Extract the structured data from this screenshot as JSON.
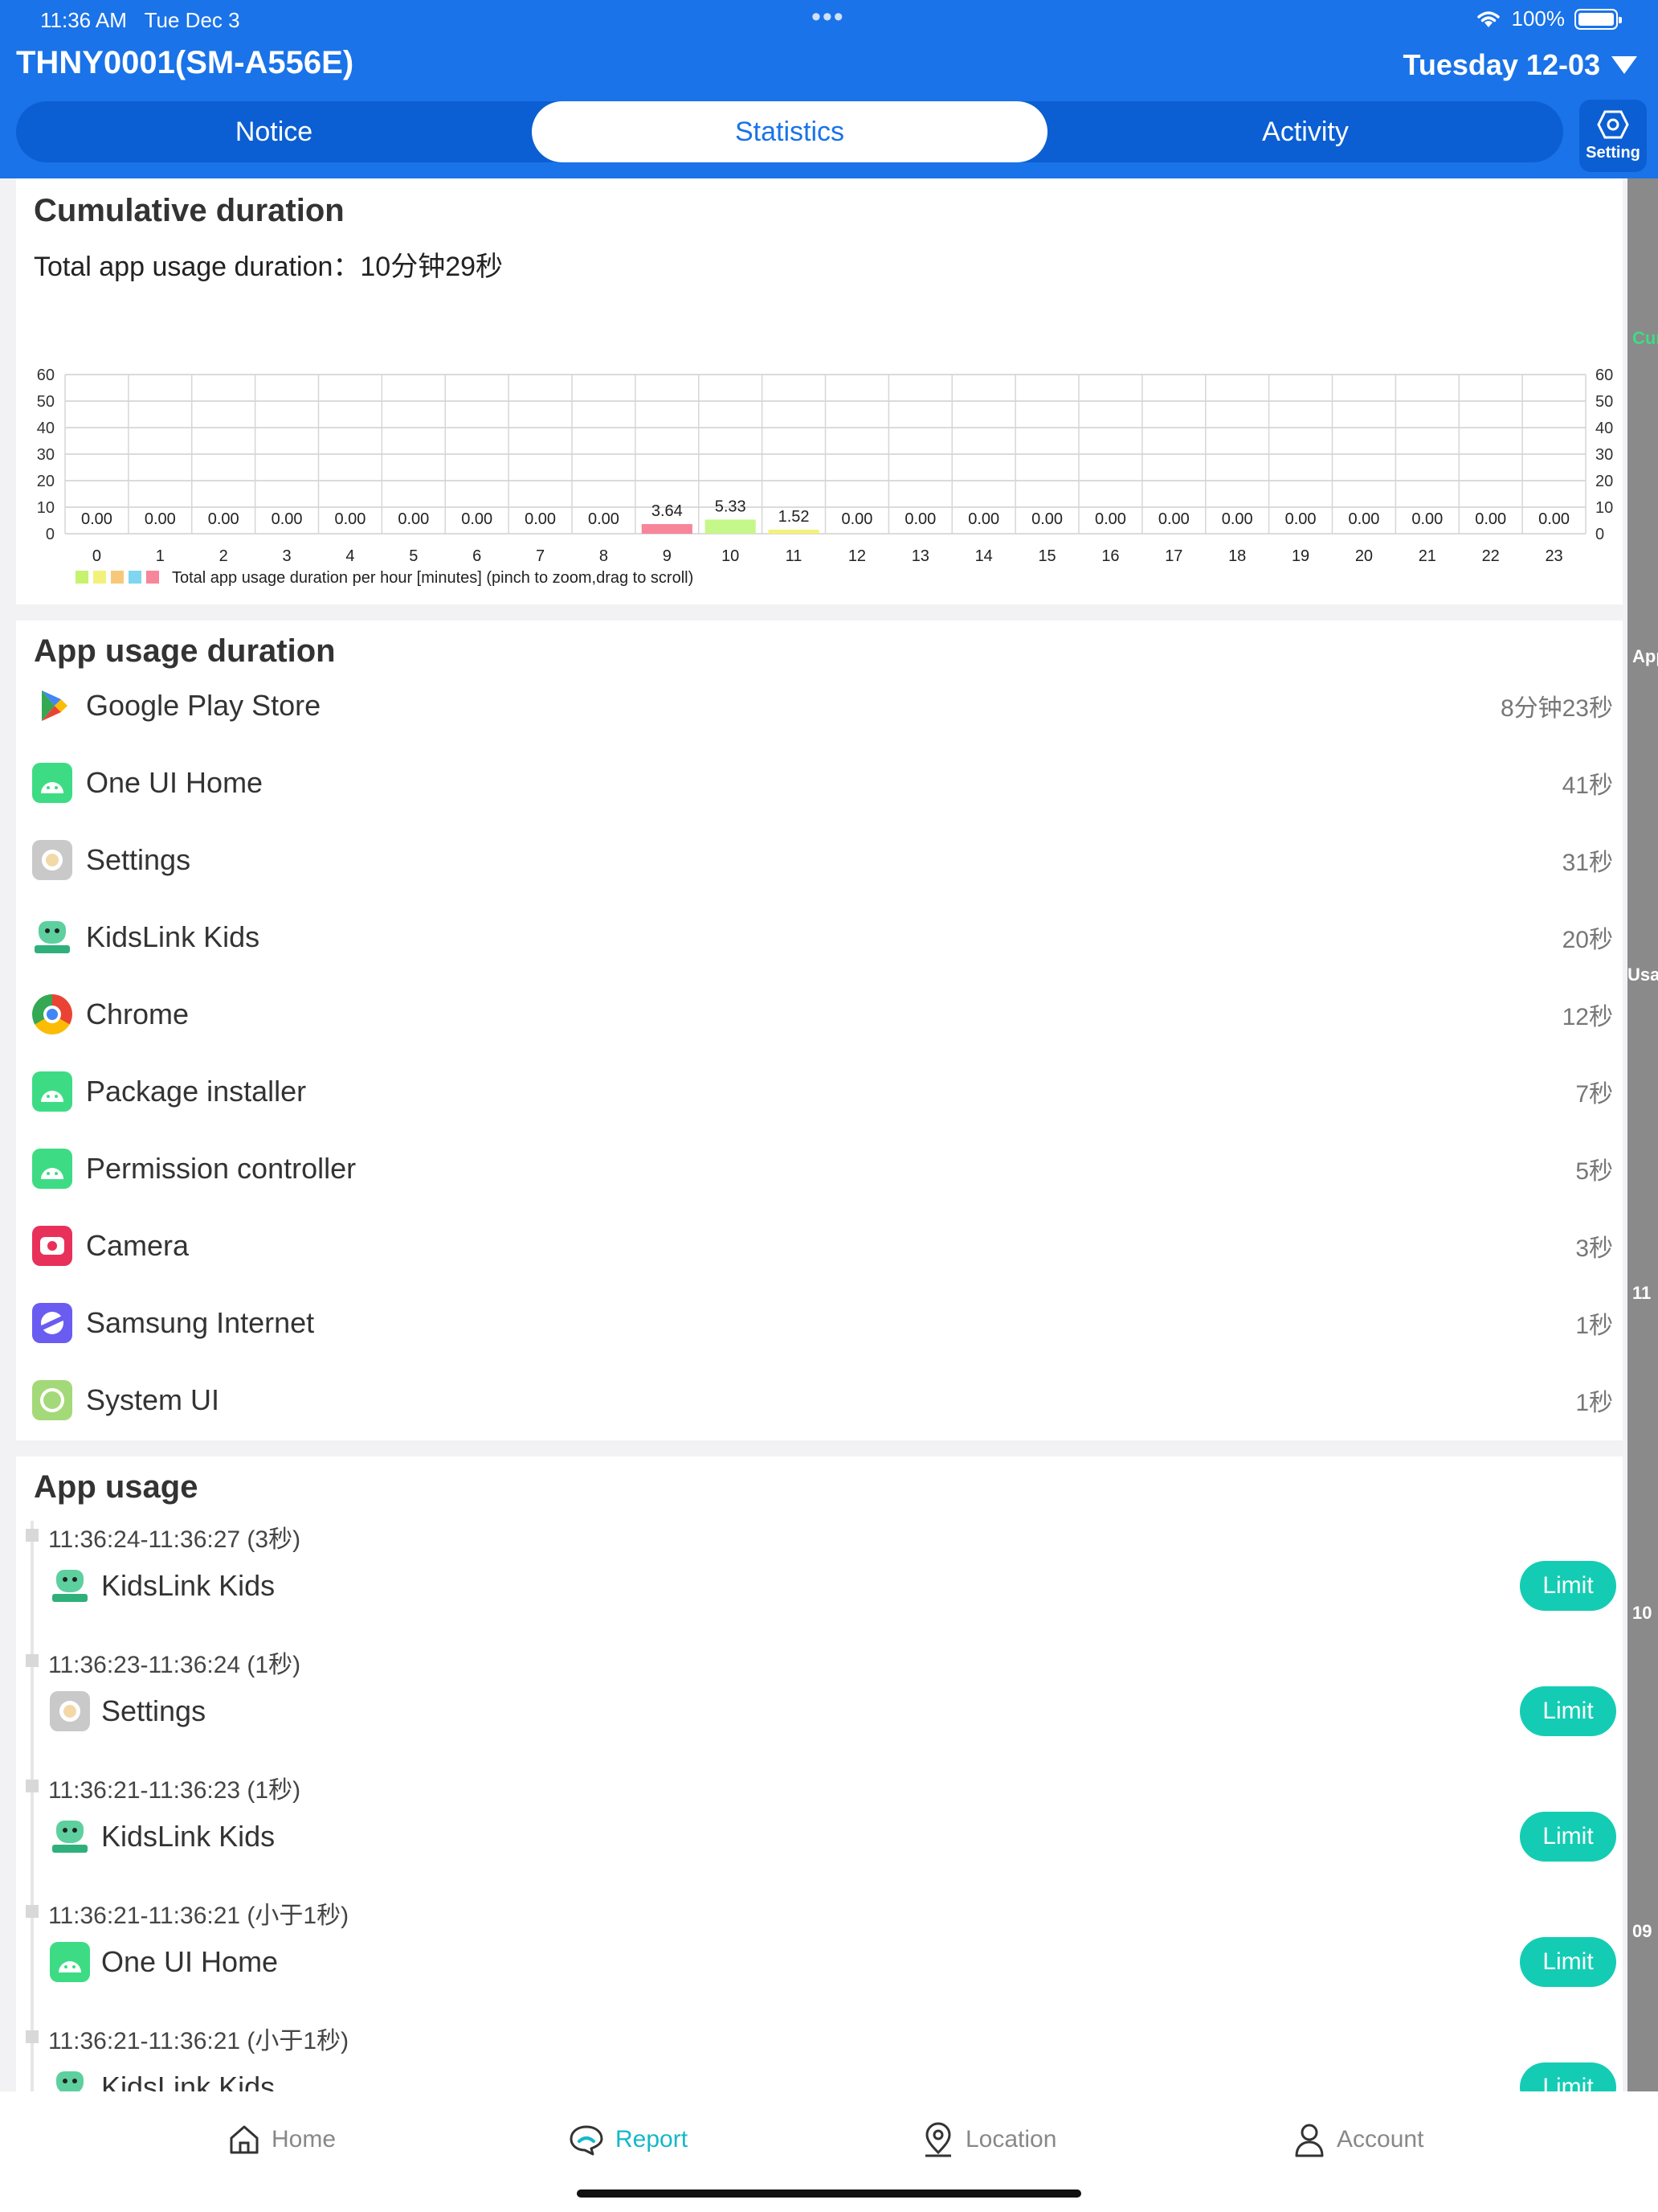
{
  "status_bar": {
    "time": "11:36 AM",
    "date": "Tue Dec 3",
    "battery": "100%"
  },
  "header": {
    "device_title": "THNY0001(SM-A556E)",
    "date_label": "Tuesday 12-03"
  },
  "tabs": [
    {
      "label": "Notice"
    },
    {
      "label": "Statistics"
    },
    {
      "label": "Activity"
    }
  ],
  "setting": {
    "label": "Setting"
  },
  "side_strip": {
    "labels": [
      "Cum",
      "App",
      "Usag",
      "11",
      "10",
      "09"
    ]
  },
  "cumulative": {
    "title": "Cumulative duration",
    "total_label": "Total app usage duration：",
    "total_value": "10分钟29秒"
  },
  "chart_data": {
    "type": "bar",
    "categories": [
      "0",
      "1",
      "2",
      "3",
      "4",
      "5",
      "6",
      "7",
      "8",
      "9",
      "10",
      "11",
      "12",
      "13",
      "14",
      "15",
      "16",
      "17",
      "18",
      "19",
      "20",
      "21",
      "22",
      "23"
    ],
    "values": [
      0,
      0,
      0,
      0,
      0,
      0,
      0,
      0,
      0,
      3.64,
      5.33,
      1.52,
      0,
      0,
      0,
      0,
      0,
      0,
      0,
      0,
      0,
      0,
      0,
      0
    ],
    "value_labels": [
      "0.00",
      "0.00",
      "0.00",
      "0.00",
      "0.00",
      "0.00",
      "0.00",
      "0.00",
      "0.00",
      "3.64",
      "5.33",
      "1.52",
      "0.00",
      "0.00",
      "0.00",
      "0.00",
      "0.00",
      "0.00",
      "0.00",
      "0.00",
      "0.00",
      "0.00",
      "0.00",
      "0.00"
    ],
    "ylim": [
      0,
      60
    ],
    "yticks": [
      "0",
      "10",
      "20",
      "30",
      "40",
      "50",
      "60"
    ],
    "legend_text": "Total app usage duration per hour [minutes] (pinch to zoom,drag to scroll)",
    "legend_colors": [
      "#c6f26e",
      "#f2f27a",
      "#f8c87a",
      "#7ed6f0",
      "#f7869a"
    ],
    "bar_colors": {
      "9": "#f7869a",
      "10": "#c6f78a",
      "11": "#f2f27a"
    },
    "grid": true
  },
  "app_duration": {
    "title": "App usage duration",
    "apps": [
      {
        "name": "Google Play Store",
        "time": "8分钟23秒",
        "icon": "play-store-icon"
      },
      {
        "name": "One UI Home",
        "time": "41秒",
        "icon": "android-icon"
      },
      {
        "name": "Settings",
        "time": "31秒",
        "icon": "settings-icon"
      },
      {
        "name": "KidsLink Kids",
        "time": "20秒",
        "icon": "kidslink-icon"
      },
      {
        "name": "Chrome",
        "time": "12秒",
        "icon": "chrome-icon"
      },
      {
        "name": "Package installer",
        "time": "7秒",
        "icon": "android-icon"
      },
      {
        "name": "Permission controller",
        "time": "5秒",
        "icon": "android-icon"
      },
      {
        "name": "Camera",
        "time": "3秒",
        "icon": "camera-icon"
      },
      {
        "name": "Samsung Internet",
        "time": "1秒",
        "icon": "samsung-internet-icon"
      },
      {
        "name": "System UI",
        "time": "1秒",
        "icon": "system-ui-icon"
      }
    ]
  },
  "app_usage": {
    "title": "App usage",
    "limit_label": "Limit",
    "entries": [
      {
        "time": "11:36:24-11:36:27 (3秒)",
        "app": "KidsLink Kids",
        "icon": "kidslink-icon"
      },
      {
        "time": "11:36:23-11:36:24 (1秒)",
        "app": "Settings",
        "icon": "settings-icon"
      },
      {
        "time": "11:36:21-11:36:23 (1秒)",
        "app": "KidsLink Kids",
        "icon": "kidslink-icon"
      },
      {
        "time": "11:36:21-11:36:21 (小于1秒)",
        "app": "One UI Home",
        "icon": "android-icon"
      },
      {
        "time": "11:36:21-11:36:21 (小于1秒)",
        "app": "KidsLink Kids",
        "icon": "kidslink-icon"
      }
    ]
  },
  "bottom_nav": [
    {
      "label": "Home",
      "icon": "home-icon"
    },
    {
      "label": "Report",
      "icon": "report-icon"
    },
    {
      "label": "Location",
      "icon": "location-icon"
    },
    {
      "label": "Account",
      "icon": "account-icon"
    }
  ],
  "colors": {
    "header": "#1a73e8",
    "accent": "#14ccb4",
    "nav_active": "#14b8c8"
  }
}
